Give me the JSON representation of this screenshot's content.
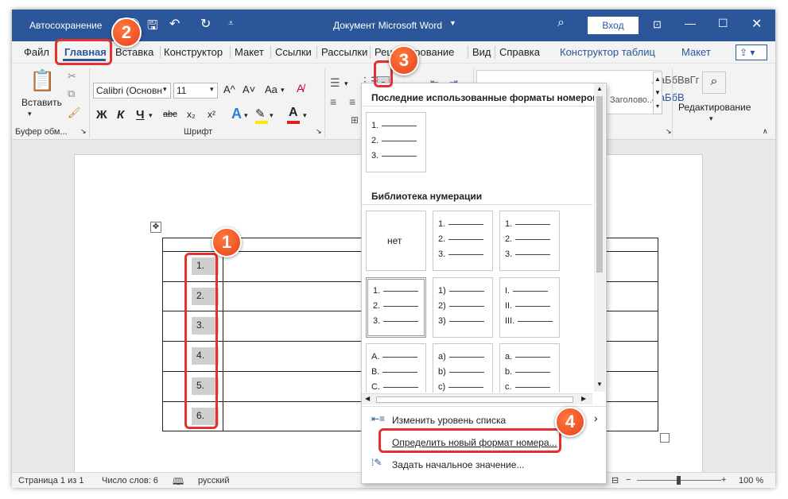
{
  "titlebar": {
    "autosave": "Автосохранение",
    "doc_title": "Документ Microsoft Word",
    "login": "Вход"
  },
  "tabs": [
    "Файл",
    "Главная",
    "Вставка",
    "Конструктор",
    "Макет",
    "Ссылки",
    "Рассылки",
    "Рецензирование",
    "Вид",
    "Справка",
    "Конструктор таблиц",
    "Макет"
  ],
  "ribbon": {
    "paste": "Вставить",
    "clipboard_group": "Буфер обм...",
    "font_name": "Calibri (Основн",
    "font_size": "11",
    "font_group": "Шрифт",
    "bold": "Ж",
    "italic": "К",
    "underline": "Ч",
    "strike": "abc",
    "sub": "x₂",
    "sup": "x²",
    "grow": "A^",
    "shrink": "A˅",
    "case": "Aa",
    "styles_preview": [
      "АаБбВвГг",
      "АаБбВвГ",
      "АаБбВ"
    ],
    "styles_label": "Заголово...",
    "editing": "Редактирование"
  },
  "document": {
    "numbers": [
      "1.",
      "2.",
      "3.",
      "4.",
      "5.",
      "6."
    ]
  },
  "menu": {
    "recent_header": "Последние использованные форматы номеров",
    "library_header": "Библиотека нумерации",
    "none_label": "нет",
    "recent_tile": [
      "1.",
      "2.",
      "3."
    ],
    "tiles": [
      [
        "1.",
        "2.",
        "3."
      ],
      [
        "1.",
        "2.",
        "3."
      ],
      [
        "1.",
        "2.",
        "3."
      ],
      [
        "1)",
        "2)",
        "3)"
      ],
      [
        "I.",
        "II.",
        "III."
      ],
      [
        "A.",
        "B.",
        "C."
      ],
      [
        "a)",
        "b)",
        "c)"
      ],
      [
        "a.",
        "b.",
        "c."
      ]
    ],
    "items": [
      "Изменить уровень списка",
      "Определить новый формат номера...",
      "Задать начальное значение..."
    ]
  },
  "status": {
    "page": "Страница 1 из 1",
    "words": "Число слов: 6",
    "lang": "русский",
    "zoom": "100 %"
  },
  "badges": [
    "1",
    "2",
    "3",
    "4"
  ],
  "colors": {
    "titlebar": "#2b579a",
    "accent_red": "#e53030",
    "badge": "#e8401e"
  }
}
